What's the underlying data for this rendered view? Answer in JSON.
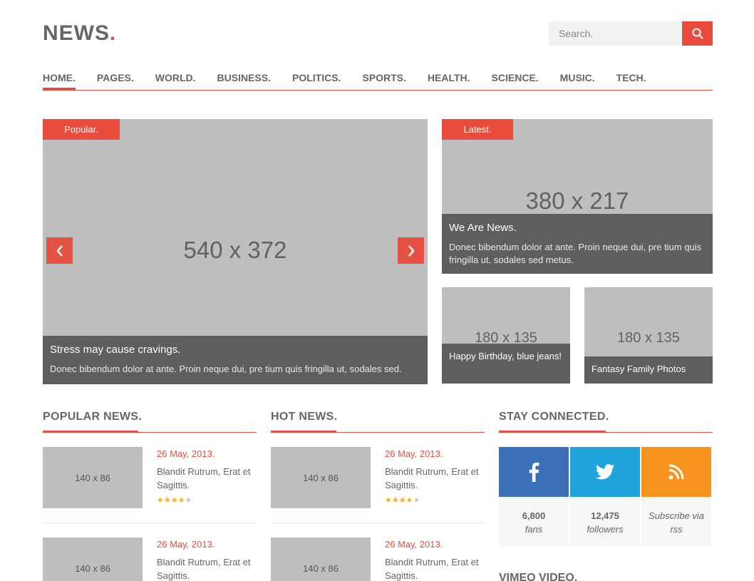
{
  "header": {
    "logo_text": "NEWS",
    "logo_dot": ".",
    "search_placeholder": "Search."
  },
  "nav": {
    "items": [
      {
        "label": "HOME."
      },
      {
        "label": "PAGES."
      },
      {
        "label": "WORLD."
      },
      {
        "label": "BUSINESS."
      },
      {
        "label": "POLITICS."
      },
      {
        "label": "SPORTS."
      },
      {
        "label": "HEALTH."
      },
      {
        "label": "SCIENCE."
      },
      {
        "label": "MUSIC."
      },
      {
        "label": "TECH."
      }
    ],
    "active": "HOME."
  },
  "featured": {
    "slider": {
      "tag": "Popular.",
      "image_label": "540 x 372",
      "title": "Stress may cause cravings.",
      "excerpt": "Donec bibendum dolor at ante. Proin neque dui, pre tium quis fringilla ut, sodales sed."
    },
    "latest": {
      "tag": "Latest.",
      "image_label": "380 x 217",
      "title": "We Are News.",
      "excerpt": "Donec bibendum dolor at ante. Proin neque dui, pre tium quis fringilla ut, sodales sed metus."
    },
    "small_left": {
      "image_label": "180 x 135",
      "title": "Happy Birthday, blue jeans!"
    },
    "small_right": {
      "image_label": "180 x 135",
      "title": "Fantasy Family Photos"
    }
  },
  "popular_news": {
    "heading": "POPULAR NEWS.",
    "items": [
      {
        "thumb": "140 x 86",
        "date": "26 May, 2013.",
        "title": "Blandit Rutrum, Erat et Sagittis.",
        "rating": 4
      },
      {
        "thumb": "140 x 86",
        "date": "26 May, 2013.",
        "title": "Blandit Rutrum, Erat et Sagittis.",
        "rating": 4
      }
    ]
  },
  "hot_news": {
    "heading": "HOT NEWS.",
    "items": [
      {
        "thumb": "140 x 86",
        "date": "26 May, 2013.",
        "title": "Blandit Rutrum, Erat et Sagittis.",
        "rating": 4
      },
      {
        "thumb": "140 x 86",
        "date": "26 May, 2013.",
        "title": "Blandit Rutrum, Erat et Sagittis.",
        "rating": 4
      }
    ]
  },
  "stay_connected": {
    "heading": "STAY CONNECTED.",
    "facebook": {
      "count": "6,800",
      "label": "fans",
      "color": "#3b6fb7",
      "icon": "facebook-icon"
    },
    "twitter": {
      "count": "12,475",
      "label": "followers",
      "color": "#1fa5dc",
      "icon": "twitter-icon"
    },
    "rss": {
      "label": "Subscribe via rss",
      "color": "#f7941d",
      "icon": "rss-icon"
    }
  },
  "vimeo": {
    "heading": "VIMEO VIDEO."
  },
  "colors": {
    "accent": "#e84c3d",
    "placeholder": "#bebebe",
    "caption_bg": "#5e5e5e"
  }
}
